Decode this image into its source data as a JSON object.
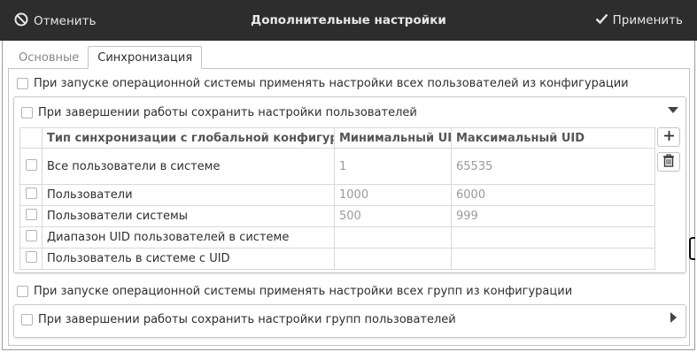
{
  "titlebar": {
    "cancel_label": "Отменить",
    "title": "Дополнительные настройки",
    "apply_label": "Применить"
  },
  "tabs": [
    {
      "label": "Основные",
      "active": false
    },
    {
      "label": "Синхронизация",
      "active": true
    }
  ],
  "settings": {
    "apply_users_on_start": "При запуске операционной системы применять настройки всех пользователей из конфигурации",
    "save_users_on_shutdown": "При завершении работы сохранить настройки пользователей",
    "apply_groups_on_start": "При запуске операционной системы применять настройки всех групп из конфигурации",
    "save_groups_on_shutdown": "При завершении работы сохранить настройки групп пользователей"
  },
  "sync_table": {
    "columns": [
      "Тип синхронизации с глобальной конфигурацией",
      "Минимальный UID",
      "Максимальный UID"
    ],
    "rows": [
      {
        "type": "Все пользователи в системе",
        "min_uid": "1",
        "max_uid": "65535"
      },
      {
        "type": "Пользователи",
        "min_uid": "1000",
        "max_uid": "6000"
      },
      {
        "type": "Пользователи системы",
        "min_uid": "500",
        "max_uid": "999"
      },
      {
        "type": "Диапазон UID пользователей в системе",
        "min_uid": "",
        "max_uid": ""
      },
      {
        "type": "Пользователь в системе с UID",
        "min_uid": "",
        "max_uid": ""
      }
    ]
  },
  "icons": {
    "cancel": "cancel-circle-icon",
    "apply": "checkmark-icon",
    "add": "plus-icon",
    "delete": "trash-icon",
    "expand": "triangle-down-icon",
    "collapse": "triangle-right-icon"
  },
  "colors": {
    "titlebar_bg": "#2d2d2d",
    "titlebar_fg": "#e8e8e8",
    "muted_text": "#9a9a9a"
  }
}
